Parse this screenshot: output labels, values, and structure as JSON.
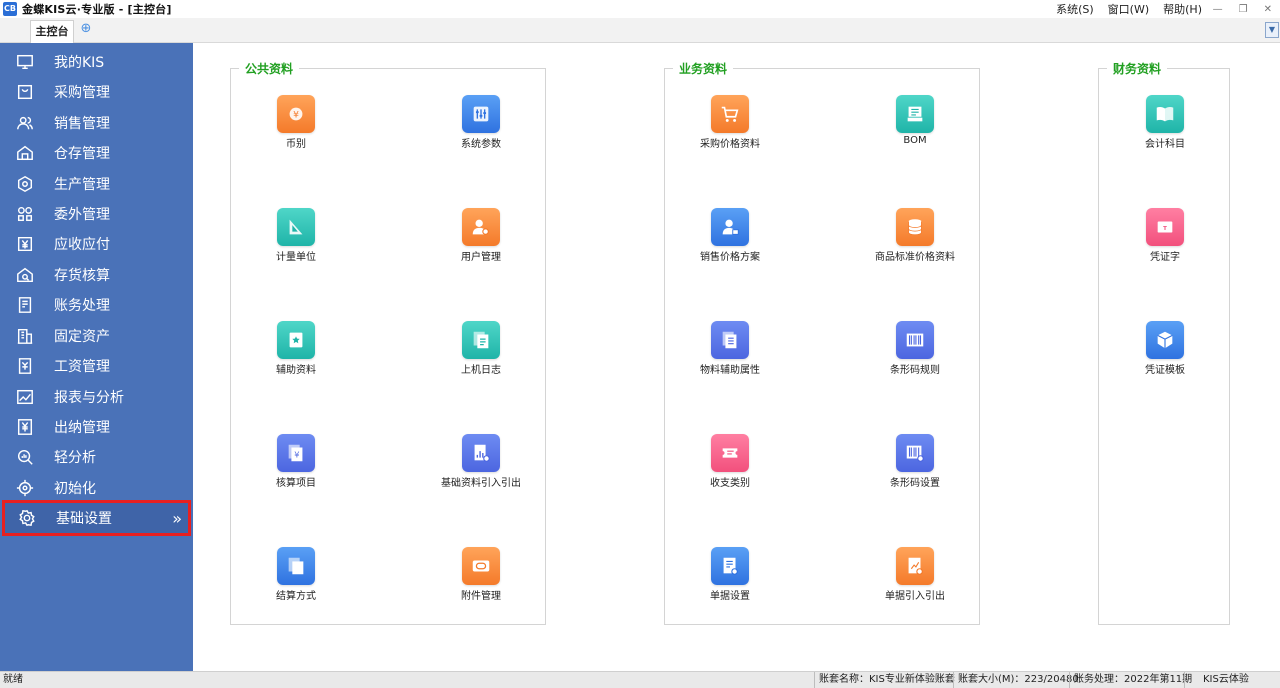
{
  "app": {
    "title": "金蝶KIS云·专业版 - [主控台]",
    "icon_text": "CB",
    "menus": [
      "系统(S)",
      "窗口(W)",
      "帮助(H)"
    ]
  },
  "tabs": [
    {
      "label": "主控台"
    }
  ],
  "sidebar": {
    "items": [
      {
        "label": "我的KIS",
        "icon": "monitor-icon"
      },
      {
        "label": "采购管理",
        "icon": "purchase-icon"
      },
      {
        "label": "销售管理",
        "icon": "people-icon"
      },
      {
        "label": "仓存管理",
        "icon": "warehouse-icon"
      },
      {
        "label": "生产管理",
        "icon": "production-icon"
      },
      {
        "label": "委外管理",
        "icon": "outsource-icon"
      },
      {
        "label": "应收应付",
        "icon": "yen-receivable-icon"
      },
      {
        "label": "存货核算",
        "icon": "inventory-icon"
      },
      {
        "label": "账务处理",
        "icon": "ledger-icon"
      },
      {
        "label": "固定资产",
        "icon": "building-icon"
      },
      {
        "label": "工资管理",
        "icon": "payroll-icon"
      },
      {
        "label": "报表与分析",
        "icon": "chart-line-icon"
      },
      {
        "label": "出纳管理",
        "icon": "cashier-icon"
      },
      {
        "label": "轻分析",
        "icon": "analysis-search-icon"
      },
      {
        "label": "初始化",
        "icon": "init-icon"
      },
      {
        "label": "基础设置",
        "icon": "gear-icon",
        "active": true
      }
    ]
  },
  "groups": [
    {
      "title": "公共资料",
      "tiles": [
        {
          "label": "币别",
          "icon": "currency-icon",
          "color": "orange"
        },
        {
          "label": "系统参数",
          "icon": "sliders-icon",
          "color": "blue"
        },
        {
          "label": "计量单位",
          "icon": "ruler-icon",
          "color": "teal"
        },
        {
          "label": "用户管理",
          "icon": "user-gear-icon",
          "color": "orange"
        },
        {
          "label": "辅助资料",
          "icon": "star-doc-icon",
          "color": "teal"
        },
        {
          "label": "上机日志",
          "icon": "log-icon",
          "color": "teal"
        },
        {
          "label": "核算项目",
          "icon": "yen-doc-icon",
          "color": "indigo"
        },
        {
          "label": "基础资料引入引出",
          "icon": "import-export-icon",
          "color": "indigo"
        },
        {
          "label": "结算方式",
          "icon": "settle-icon",
          "color": "blue"
        },
        {
          "label": "附件管理",
          "icon": "attachment-icon",
          "color": "orange"
        }
      ]
    },
    {
      "title": "业务资料",
      "tiles": [
        {
          "label": "采购价格资料",
          "icon": "cart-icon",
          "color": "orange"
        },
        {
          "label": "BOM",
          "icon": "bom-icon",
          "color": "teal"
        },
        {
          "label": "销售价格方案",
          "icon": "sales-user-icon",
          "color": "blue"
        },
        {
          "label": "商品标准价格资料",
          "icon": "coins-stack-icon",
          "color": "orange"
        },
        {
          "label": "物料辅助属性",
          "icon": "material-doc-icon",
          "color": "indigo"
        },
        {
          "label": "条形码规则",
          "icon": "barcode-icon",
          "color": "indigo"
        },
        {
          "label": "收支类别",
          "icon": "ticket-icon",
          "color": "pink"
        },
        {
          "label": "条形码设置",
          "icon": "barcode-gear-icon",
          "color": "indigo"
        },
        {
          "label": "单据设置",
          "icon": "doc-gear-icon",
          "color": "blue"
        },
        {
          "label": "单据引入引出",
          "icon": "doc-transfer-icon",
          "color": "orange"
        }
      ]
    },
    {
      "title": "财务资料",
      "tiles": [
        {
          "label": "会计科目",
          "icon": "book-icon",
          "color": "teal"
        },
        {
          "label": "凭证字",
          "icon": "voucher-word-icon",
          "color": "pink"
        },
        {
          "label": "凭证模板",
          "icon": "template-cube-icon",
          "color": "blue"
        }
      ]
    }
  ],
  "statusbar": {
    "ready": "就绪",
    "account_name": "账套名称：KIS专业新体验账套",
    "account_size": "账套大小(M)：223/20480",
    "period": "账务处理：2022年第11期",
    "edition": "KIS云体验"
  }
}
